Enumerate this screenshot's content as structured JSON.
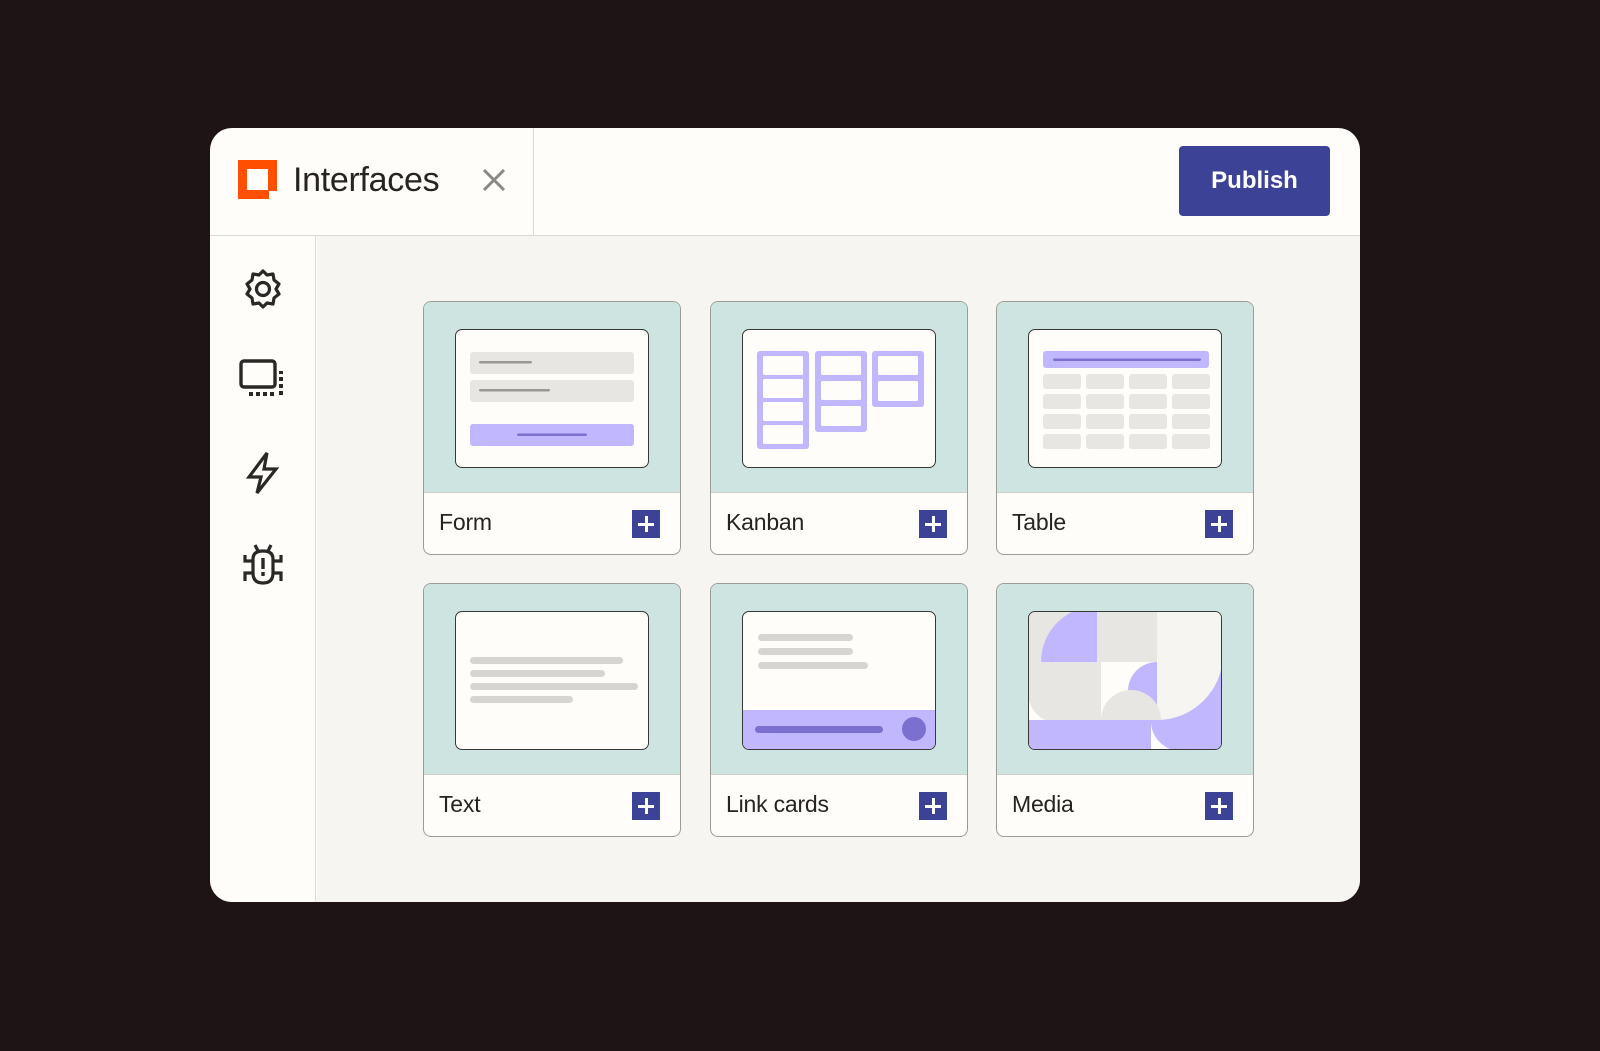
{
  "header": {
    "app_title": "Interfaces",
    "logo_icon": "app-logo-icon",
    "close_icon": "close-icon",
    "publish_label": "Publish"
  },
  "sidebar": {
    "items": [
      {
        "id": "settings",
        "icon": "gear-icon"
      },
      {
        "id": "layouts",
        "icon": "screens-icon"
      },
      {
        "id": "automations",
        "icon": "lightning-icon"
      },
      {
        "id": "debug",
        "icon": "bug-icon"
      }
    ]
  },
  "components": [
    {
      "label": "Form",
      "preview": "form"
    },
    {
      "label": "Kanban",
      "preview": "kanban"
    },
    {
      "label": "Table",
      "preview": "table"
    },
    {
      "label": "Text",
      "preview": "text"
    },
    {
      "label": "Link cards",
      "preview": "link-cards"
    },
    {
      "label": "Media",
      "preview": "media"
    }
  ],
  "colors": {
    "accent": "#3c4397",
    "brand_orange": "#ff4f00",
    "preview_bg": "#cee4e0",
    "lavender": "#c1b7ff",
    "purple_dark": "#7b6fd0",
    "backdrop": "#1e1415"
  }
}
